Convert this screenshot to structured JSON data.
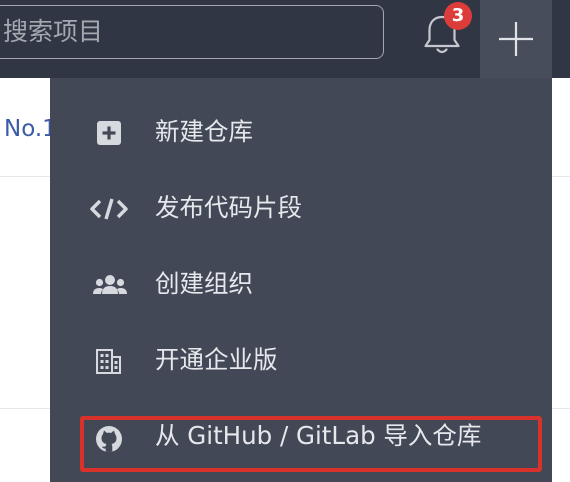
{
  "header": {
    "search_placeholder": "搜索项目",
    "notification_count": "3"
  },
  "background": {
    "text": "No.1"
  },
  "dropdown": {
    "items": [
      {
        "icon": "plus-square-icon",
        "label": "新建仓库"
      },
      {
        "icon": "code-icon",
        "label": "发布代码片段"
      },
      {
        "icon": "users-icon",
        "label": "创建组织"
      },
      {
        "icon": "building-icon",
        "label": "开通企业版"
      },
      {
        "icon": "github-icon",
        "label": "从 GitHub / GitLab 导入仓库"
      }
    ]
  },
  "colors": {
    "topbar": "#303643",
    "dropdown": "#434857",
    "badge": "#dc3c3a",
    "highlight": "#d8322a",
    "link": "#3b5ba8"
  }
}
